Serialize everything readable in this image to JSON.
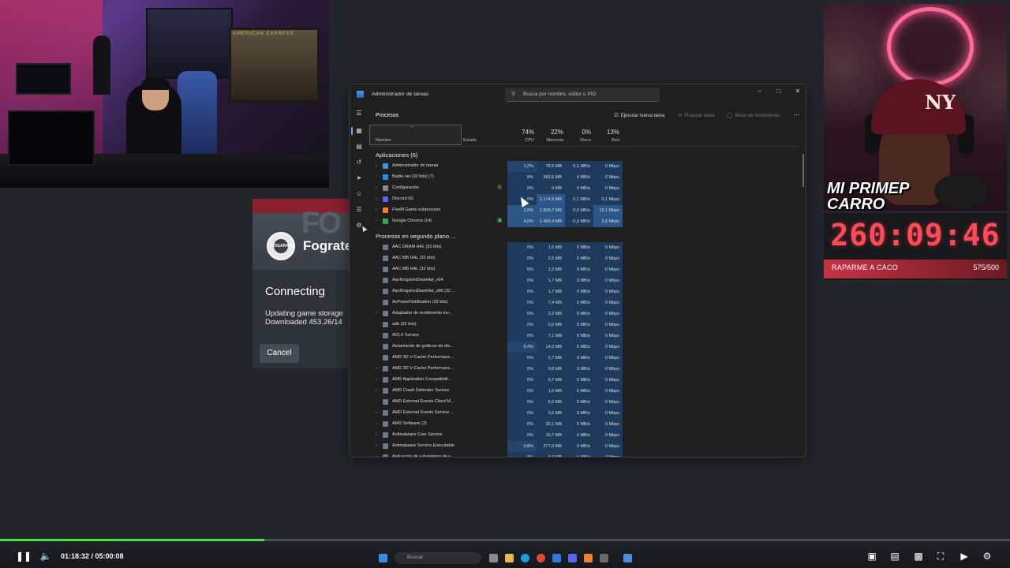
{
  "stream": {
    "overlay_title": "MI PRIMEP CARRO",
    "timer": "260:09:46",
    "goal_label": "RAPARME A CACO",
    "goal_count": "575/500",
    "poster_text": "AMERICAN EXPRESS"
  },
  "launcher": {
    "brand": "Fograte",
    "logo_text": "FOGARATE",
    "status": "Connecting",
    "detail_line1": "Updating game storage",
    "detail_line2": "Downloaded 453.26/14",
    "cancel_label": "Cancel"
  },
  "taskmgr": {
    "title": "Administrador de tareas",
    "search_placeholder": "Busca por nombre, editor o PID",
    "section": "Procesos",
    "commands": {
      "new_task": "Ejecutar nueva tarea",
      "end_task": "Finalizar tarea",
      "efficiency": "Modo de rendimiento"
    },
    "columns": {
      "name": "Nombre",
      "status": "Estado",
      "cpu_label": "CPU",
      "cpu_pct": "74%",
      "mem_label": "Memoria",
      "mem_pct": "22%",
      "disk_label": "Disco",
      "disk_pct": "0%",
      "net_label": "Red",
      "net_pct": "13%"
    },
    "groups": {
      "apps": "Aplicaciones (6)",
      "background": "Procesos en segundo plano ..."
    },
    "apps": [
      {
        "name": "Administrador de tareas",
        "cpu": "1,2%",
        "mem": "78,5 MB",
        "disk": "0,1 MB/s",
        "net": "0 Mbps",
        "icon": "#4a90e0",
        "status": ""
      },
      {
        "name": "Battle.net (32 bits) (7)",
        "cpu": "0%",
        "mem": "382,5 MB",
        "disk": "0 MB/s",
        "net": "0 Mbps",
        "icon": "#2a8ae8",
        "status": ""
      },
      {
        "name": "Configuración",
        "cpu": "0%",
        "mem": "0 MB",
        "disk": "0 MB/s",
        "net": "0 Mbps",
        "icon": "#888888",
        "status": "paused"
      },
      {
        "name": "Discord (6)",
        "cpu": "0%",
        "mem": "1.174,9 MB",
        "disk": "0,1 MB/s",
        "net": "0,1 Mbps",
        "icon": "#5865f2",
        "status": ""
      },
      {
        "name": "FiveM Game subprocess",
        "cpu": "2,0%",
        "mem": "1.809,7 MB",
        "disk": "0,9 MB/s",
        "net": "12,1 Mbps",
        "icon": "#f08030",
        "status": ""
      },
      {
        "name": "Google Chrome (14)",
        "cpu": "4,0%",
        "mem": "1.483,4 MB",
        "disk": "0,3 MB/s",
        "net": "2,8 Mbps",
        "icon": "#34a853",
        "status": "efficiency"
      }
    ],
    "background": [
      {
        "name": "AAC DRAM HAL (32 bits)",
        "cpu": "0%",
        "mem": "1,6 MB",
        "disk": "0 MB/s",
        "net": "0 Mbps",
        "expand": false
      },
      {
        "name": "AAC MB HAL (32 bits)",
        "cpu": "0%",
        "mem": "2,5 MB",
        "disk": "0 MB/s",
        "net": "0 Mbps",
        "expand": false
      },
      {
        "name": "AAC MB HAL (32 bits)",
        "cpu": "0%",
        "mem": "2,2 MB",
        "disk": "0 MB/s",
        "net": "0 Mbps",
        "expand": false
      },
      {
        "name": "AacKingstonDramHal_x64",
        "cpu": "0%",
        "mem": "1,7 MB",
        "disk": "0 MB/s",
        "net": "0 Mbps",
        "expand": false
      },
      {
        "name": "AacKingstonDramHal_x86 (32 ...",
        "cpu": "0%",
        "mem": "1,7 MB",
        "disk": "0 MB/s",
        "net": "0 Mbps",
        "expand": false
      },
      {
        "name": "AcPowerNotification (32 bits)",
        "cpu": "0%",
        "mem": "7,4 MB",
        "disk": "0 MB/s",
        "net": "0 Mbps",
        "expand": false
      },
      {
        "name": "Adaptador de rendimiento inv...",
        "cpu": "0%",
        "mem": "2,2 MB",
        "disk": "0 MB/s",
        "net": "0 Mbps",
        "expand": true
      },
      {
        "name": "adb (32 bits)",
        "cpu": "0%",
        "mem": "0,6 MB",
        "disk": "0 MB/s",
        "net": "0 Mbps",
        "expand": false
      },
      {
        "name": "ADLX Service",
        "cpu": "0%",
        "mem": "7,1 MB",
        "disk": "0 MB/s",
        "net": "0 Mbps",
        "expand": false
      },
      {
        "name": "Aislamiento de gráficos de dis...",
        "cpu": "0,4%",
        "mem": "14,0 MB",
        "disk": "0 MB/s",
        "net": "0 Mbps",
        "expand": false
      },
      {
        "name": "AMD 3D V-Cache Performanc...",
        "cpu": "0%",
        "mem": "0,7 MB",
        "disk": "0 MB/s",
        "net": "0 Mbps",
        "expand": false
      },
      {
        "name": "AMD 3D V-Cache Performanc...",
        "cpu": "0%",
        "mem": "0,8 MB",
        "disk": "0 MB/s",
        "net": "0 Mbps",
        "expand": true
      },
      {
        "name": "AMD Application Compatibilit...",
        "cpu": "0%",
        "mem": "0,7 MB",
        "disk": "0 MB/s",
        "net": "0 Mbps",
        "expand": true
      },
      {
        "name": "AMD Crash Defender Service",
        "cpu": "0%",
        "mem": "1,6 MB",
        "disk": "0 MB/s",
        "net": "0 Mbps",
        "expand": true
      },
      {
        "name": "AMD External Events Client M...",
        "cpu": "0%",
        "mem": "5,0 MB",
        "disk": "0 MB/s",
        "net": "0 Mbps",
        "expand": false
      },
      {
        "name": "AMD External Events Service ...",
        "cpu": "0%",
        "mem": "3,6 MB",
        "disk": "0 MB/s",
        "net": "0 Mbps",
        "expand": true
      },
      {
        "name": "AMD Software (3)",
        "cpu": "0%",
        "mem": "30,1 MB",
        "disk": "0 MB/s",
        "net": "0 Mbps",
        "expand": true
      },
      {
        "name": "Antimalware Core Service",
        "cpu": "0%",
        "mem": "15,7 MB",
        "disk": "0 MB/s",
        "net": "0 Mbps",
        "expand": true
      },
      {
        "name": "Antimalware Service Executable",
        "cpu": "0,8%",
        "mem": "277,0 MB",
        "disk": "0 MB/s",
        "net": "0 Mbps",
        "expand": true
      },
      {
        "name": "Aplicación de subsistema de s...",
        "cpu": "0%",
        "mem": "4,0 MB",
        "disk": "0 MB/s",
        "net": "0 Mbps",
        "expand": true
      }
    ]
  },
  "player": {
    "time": "01:18:32 / 05:00:08",
    "progress": 0.262,
    "accent": "#4ce04a"
  },
  "windows_taskbar": {
    "search_placeholder": "Buscar"
  },
  "colors": {
    "cpu_heat_1": "#1e3a5c",
    "cpu_heat_2": "#24466e",
    "cpu_heat_3": "#2c5688",
    "timer_red": "#ff4a5a"
  }
}
